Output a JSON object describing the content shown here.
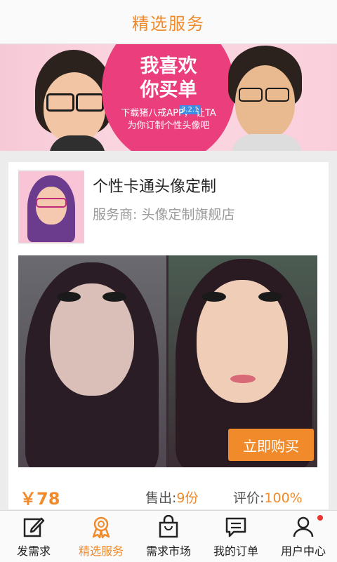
{
  "header": {
    "title": "精选服务"
  },
  "banner": {
    "headline_line1": "我喜欢",
    "headline_line2": "你买单",
    "version_badge": "3.2.1",
    "sub_line1": "下载猪八戒APP，  让TA",
    "sub_line2": "为你订制个性头像吧",
    "accent_color": "#ea3f7c"
  },
  "service": {
    "title": "个性卡通头像定制",
    "provider_label": "服务商:",
    "provider_name": "头像定制旗舰店",
    "buy_label": "立即购买",
    "price": "￥78",
    "sold_label": "售出:",
    "sold_value": "9份",
    "rating_label": "评价:",
    "rating_value": "100%"
  },
  "tabbar": {
    "active_color": "#f08a2a",
    "items": [
      {
        "label": "发需求",
        "icon": "edit-icon"
      },
      {
        "label": "精选服务",
        "icon": "badge-icon",
        "active": true
      },
      {
        "label": "需求市场",
        "icon": "shopping-bag-icon"
      },
      {
        "label": "我的订单",
        "icon": "message-icon"
      },
      {
        "label": "用户中心",
        "icon": "user-icon",
        "badge_dot": true
      }
    ]
  }
}
